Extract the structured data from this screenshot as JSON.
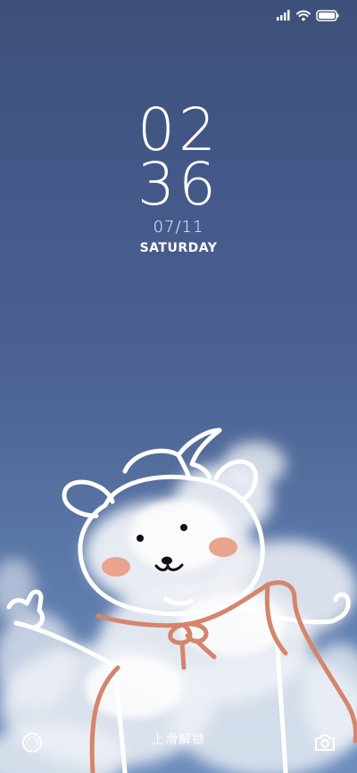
{
  "lock_screen": {
    "time": {
      "hours": "02",
      "minutes": "36"
    },
    "date": "07/11",
    "weekday": "SATURDAY",
    "unlock_hint": "上滑解锁"
  },
  "status_bar": {
    "icons": [
      "cellular-signal-icon",
      "wifi-icon",
      "battery-icon"
    ]
  },
  "shortcuts": {
    "left": "voice-assistant-icon",
    "right": "camera-icon"
  },
  "colors": {
    "sky_top": "#3d5079",
    "sky_bottom": "#6d8dbd",
    "cheek": "#e8a48c",
    "scarf": "#d4856a",
    "line": "#ffffff"
  }
}
